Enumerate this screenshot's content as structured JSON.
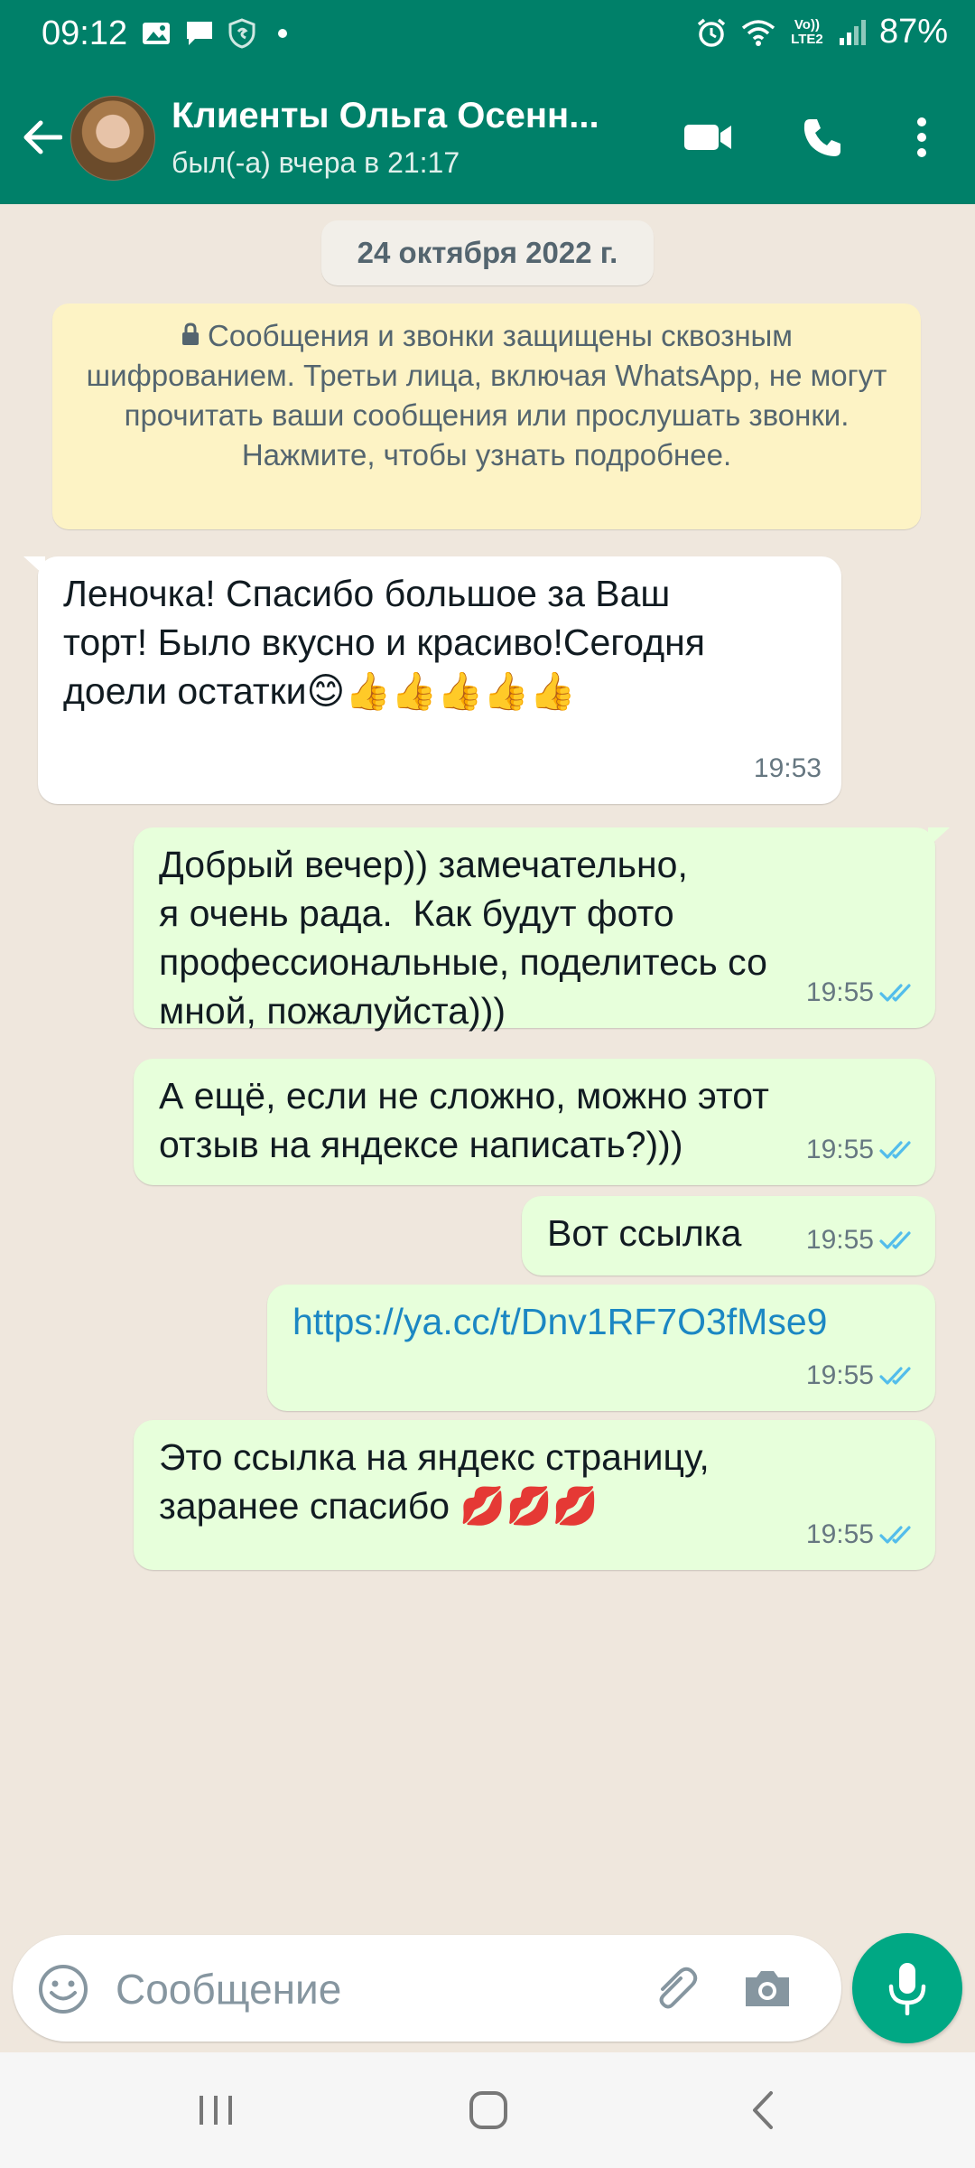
{
  "status_bar": {
    "time": "09:12",
    "battery": "87%",
    "network_label": "Vo)) LTE2"
  },
  "header": {
    "contact_name": "Клиенты Ольга Осенн...",
    "last_seen": "был(-а) вчера в 21:17",
    "accent_color": "#008069"
  },
  "chat": {
    "date_chip": "24 октября 2022 г.",
    "encryption_notice": "Сообщения и звонки защищены сквозным шифрованием. Третьи лица, включая WhatsApp, не могут прочитать ваши сообщения или прослушать звонки. Нажмите, чтобы узнать подробнее.",
    "messages": [
      {
        "direction": "incoming",
        "text": "Леночка! Спасибо большое за Ваш\nторт! Было вкусно и красиво!Сегодня\nдоели остатки😊👍👍👍👍👍",
        "time": "19:53"
      },
      {
        "direction": "outgoing",
        "text": "Добрый вечер)) замечательно,\nя очень рада.  Как будут фото\nпрофессиональные, поделитесь со\nмной, пожалуйста)))",
        "time": "19:55",
        "status": "read"
      },
      {
        "direction": "outgoing",
        "text": "А ещё, если не сложно, можно этот\nотзыв на яндексе написать?)))",
        "time": "19:55",
        "status": "read"
      },
      {
        "direction": "outgoing",
        "text": "Вот ссылка",
        "time": "19:55",
        "status": "read"
      },
      {
        "direction": "outgoing",
        "text": "https://ya.cc/t/Dnv1RF7O3fMse9",
        "time": "19:55",
        "status": "read",
        "is_link": true
      },
      {
        "direction": "outgoing",
        "text": "Это ссылка на яндекс страницу,\nзаранее спасибо 💋💋💋",
        "time": "19:55",
        "status": "read"
      }
    ]
  },
  "composer": {
    "placeholder": "Сообщение",
    "value": ""
  },
  "icons": {
    "back": "arrow-left-icon",
    "video": "video-camera-icon",
    "call": "phone-icon",
    "menu": "more-vert-icon",
    "emoji": "emoji-icon",
    "attach": "paperclip-icon",
    "camera": "camera-icon",
    "mic": "microphone-icon",
    "lock": "lock-icon",
    "read_receipt": "double-check-icon"
  },
  "colors": {
    "incoming_bubble": "#ffffff",
    "outgoing_bubble": "#e7ffdb",
    "chat_background": "#efe7dd",
    "read_tick": "#53bdeb",
    "link": "#1b87c3"
  }
}
